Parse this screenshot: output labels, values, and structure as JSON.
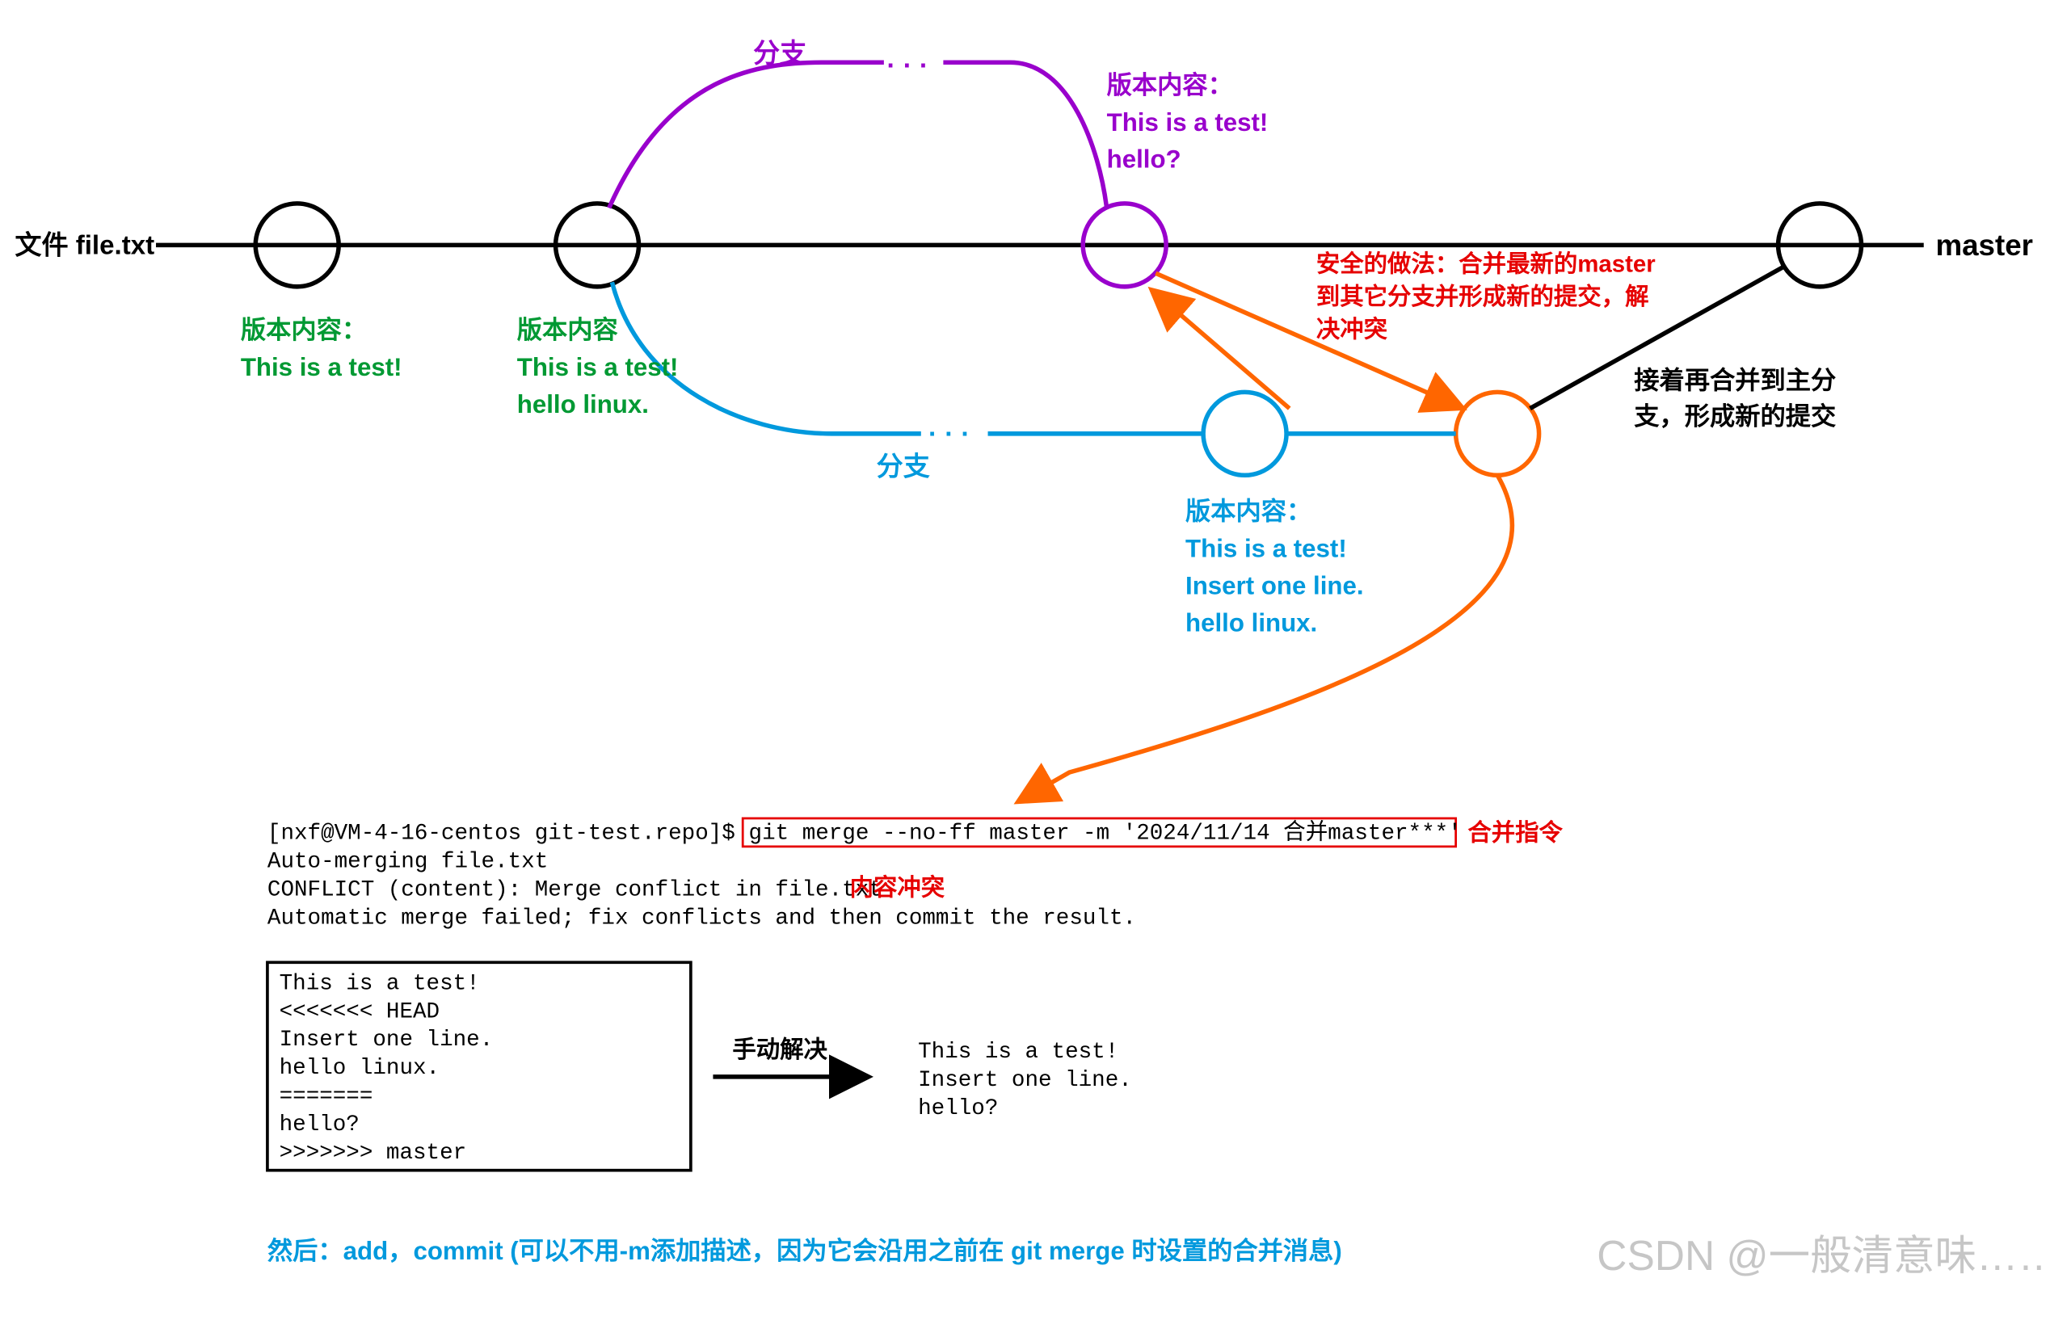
{
  "file_label": "文件 file.txt",
  "master_label": "master",
  "branch_top": "分支",
  "branch_bottom": "分支",
  "c1": {
    "title": "版本内容：",
    "l1": "This is a test!"
  },
  "c2": {
    "title": "版本内容",
    "l1": "This is a test!",
    "l2": "hello linux."
  },
  "c3": {
    "title": "版本内容：",
    "l1": "This is a test!",
    "l2": "hello?"
  },
  "c4": {
    "title": "版本内容：",
    "l1": "This is a test!",
    "l2": "Insert one line.",
    "l3": "hello linux."
  },
  "safe_note_1": "安全的做法：合并最新的master",
  "safe_note_2": "到其它分支并形成新的提交，解",
  "safe_note_3": "决冲突",
  "then_note_1": "接着再合并到主分",
  "then_note_2": "支，形成新的提交",
  "term_prompt": "[nxf@VM-4-16-centos git-test.repo]$ ",
  "term_cmd": "git merge --no-ff master -m '2024/11/14 合并master***'",
  "term_out1": "Auto-merging file.txt",
  "term_out2a": "CONFLICT (content): Merge conflict in file.txt",
  "term_out2b": "内容冲突",
  "term_out3": "Automatic merge failed; fix conflicts and then commit the result.",
  "merge_label": "合并指令",
  "conflict_box": {
    "l1": "This is a test!",
    "l2": "<<<<<<< HEAD",
    "l3": "Insert one line.",
    "l4": "hello linux.",
    "l5": "=======",
    "l6": "hello?",
    "l7": ">>>>>>> master"
  },
  "manual_fix": "手动解决",
  "resolved": {
    "l1": "This is a test!",
    "l2": "Insert one line.",
    "l3": "hello?"
  },
  "footer": "然后：add，commit (可以不用-m添加描述，因为它会沿用之前在 git merge 时设置的合并消息)",
  "watermark": "CSDN @一般清意味……"
}
